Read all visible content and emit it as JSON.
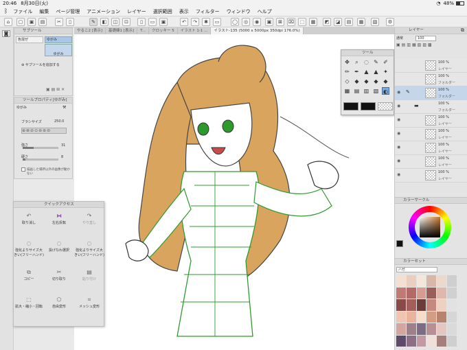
{
  "status": {
    "time": "20:46",
    "date": "8月30日(火)",
    "battery": "48%"
  },
  "menu": [
    "ファイル",
    "編集",
    "ページ管理",
    "アニメーション",
    "レイヤー",
    "選択範囲",
    "表示",
    "フィルター",
    "ウィンドウ",
    "ヘルプ"
  ],
  "tabs": [
    "やるこ2 [表示]",
    "基礎練1 [表示]",
    "T...",
    "クロッキー 5",
    "イラスト 1-1 ...",
    "イラスト-135 (5000 x 5000px 350dpi 176.0%)"
  ],
  "subtool": {
    "header": "サブツール",
    "tool_left": "色混ぜ",
    "tool_right": "ゆがみ",
    "add": "サブツールを追加する"
  },
  "toolprop": {
    "header": "ツールプロパティ[ゆがみ]",
    "name": "ゆがみ",
    "brush_size_label": "ブラシサイズ",
    "brush_size": "250.0",
    "strength_label": "強さ",
    "strength": "31",
    "hardness_label": "硬さ",
    "hardness": "8",
    "checkbox": "描画した場所以外の画像が動かない"
  },
  "quick": {
    "header": "クイックアクセス",
    "items": [
      {
        "label": "取り消し",
        "icon": "undo-icon",
        "dim": false
      },
      {
        "label": "左右反転",
        "icon": "flip-icon",
        "dim": false
      },
      {
        "label": "やり直し",
        "icon": "redo-icon",
        "dim": true
      },
      {
        "label": "強化よりサイズ大きい(フリーハンド)",
        "icon": "lasso-icon",
        "dim": false
      },
      {
        "label": "投げなわ選択",
        "icon": "lasso-icon",
        "dim": false
      },
      {
        "label": "強化よりサイズ大きい(フリーハンド)",
        "icon": "lasso-icon",
        "dim": false
      },
      {
        "label": "コピー",
        "icon": "copy-icon",
        "dim": false
      },
      {
        "label": "切り取り",
        "icon": "cut-icon",
        "dim": false
      },
      {
        "label": "貼り付け",
        "icon": "paste-icon",
        "dim": true
      },
      {
        "label": "拡大・縮小・回転",
        "icon": "transform-icon",
        "dim": false
      },
      {
        "label": "自由変形",
        "icon": "free-transform-icon",
        "dim": false
      },
      {
        "label": "メッシュ変形",
        "icon": "mesh-icon",
        "dim": false
      }
    ]
  },
  "layers_panel": {
    "header": "レイヤー",
    "blend": "通常",
    "opacity": "100",
    "layers": [
      {
        "pct": "100 %",
        "name": "レイヤー"
      },
      {
        "pct": "100 %",
        "name": "フォルダー"
      },
      {
        "pct": "100 %",
        "name": "フォルダー"
      },
      {
        "pct": "100 %",
        "name": "フォルダー"
      },
      {
        "pct": "100 %",
        "name": "レイヤー"
      },
      {
        "pct": "100 %",
        "name": "レイヤー"
      },
      {
        "pct": "100 %",
        "name": "レイヤー"
      },
      {
        "pct": "100 %",
        "name": "レイヤー"
      },
      {
        "pct": "100 %",
        "name": "レイヤー"
      }
    ]
  },
  "toolpalette": {
    "header": "ツール"
  },
  "color_circle": {
    "header": "カラーサークル"
  },
  "color_set": {
    "header": "カラーセット",
    "name": "ハゼ"
  },
  "colors": {
    "accent": "#2f6fd0",
    "hair": "#d9a45e",
    "line": "#333333",
    "green": "#2e9a2e"
  }
}
